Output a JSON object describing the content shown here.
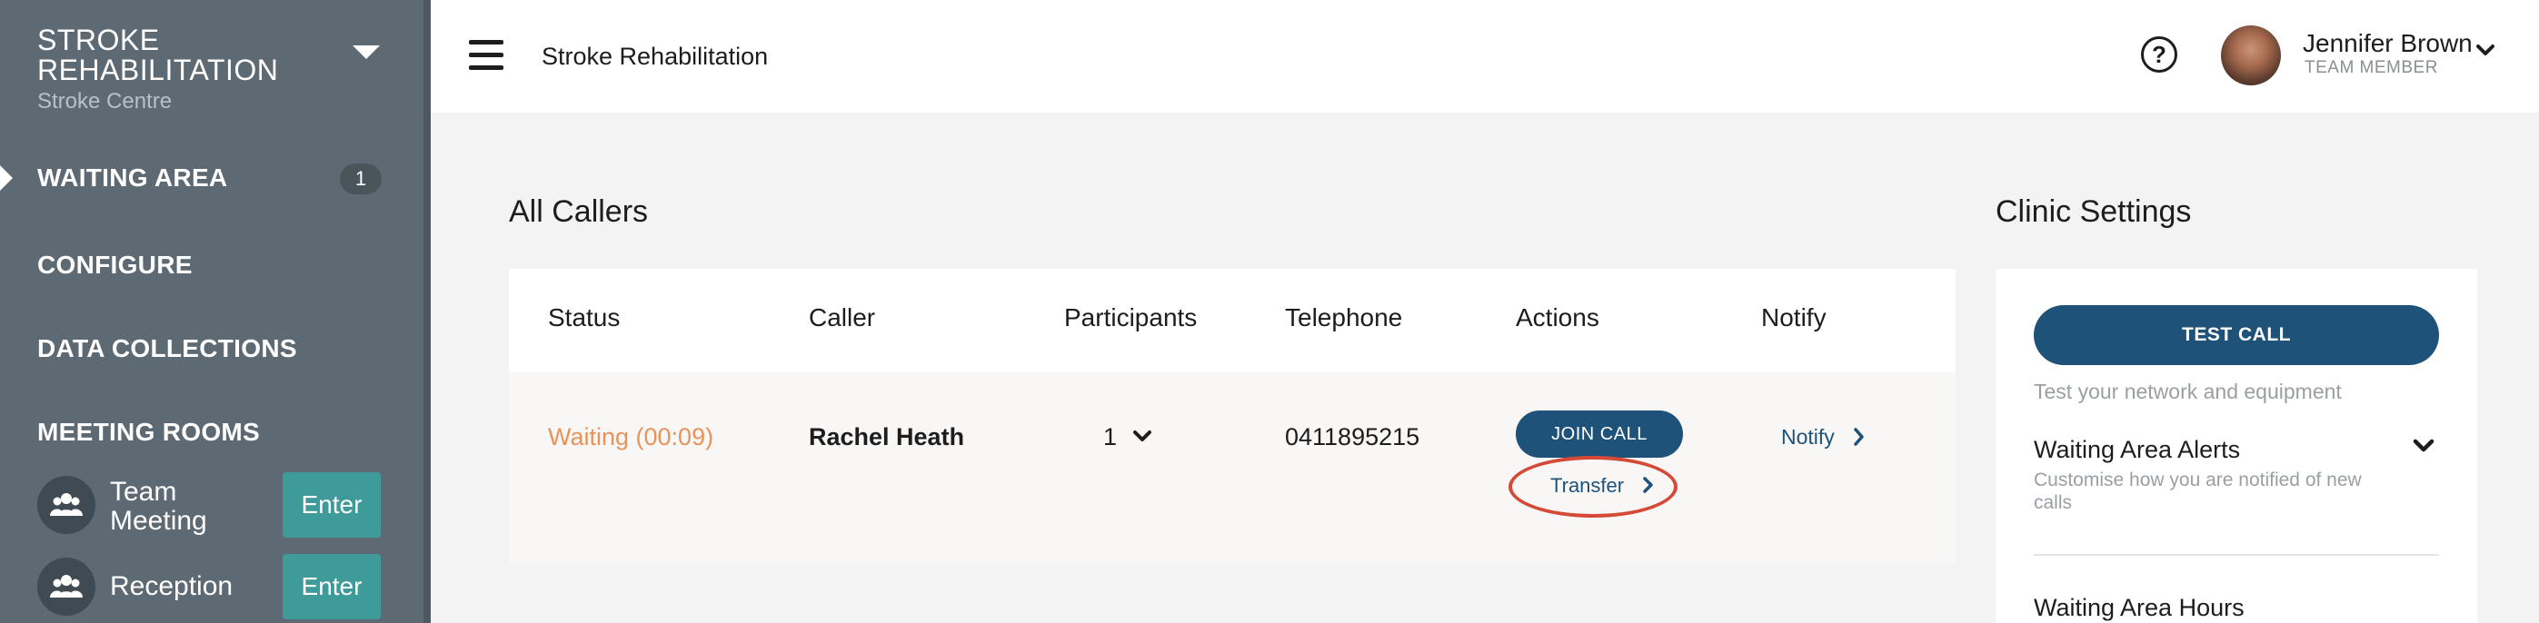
{
  "sidebar": {
    "clinic_name": "STROKE REHABILITATION",
    "clinic_subtitle": "Stroke Centre",
    "nav": {
      "waiting_area": "WAITING AREA",
      "waiting_area_count": "1",
      "configure": "CONFIGURE",
      "data_collections": "DATA COLLECTIONS",
      "meeting_rooms": "MEETING ROOMS"
    },
    "rooms": [
      {
        "label": "Team Meeting",
        "enter_label": "Enter"
      },
      {
        "label": "Reception",
        "enter_label": "Enter"
      }
    ]
  },
  "header": {
    "title": "Stroke Rehabilitation",
    "help_icon": "?",
    "user": {
      "name": "Jennifer Brown",
      "role": "TEAM MEMBER"
    }
  },
  "callers": {
    "title": "All Callers",
    "columns": {
      "status": "Status",
      "caller": "Caller",
      "participants": "Participants",
      "telephone": "Telephone",
      "actions": "Actions",
      "notify": "Notify"
    },
    "rows": [
      {
        "status": "Waiting (00:09)",
        "caller": "Rachel Heath",
        "participants": "1",
        "telephone": "0411895215",
        "join_label": "JOIN CALL",
        "transfer_label": "Transfer",
        "notify_label": "Notify"
      }
    ]
  },
  "settings": {
    "title": "Clinic Settings",
    "test_call_label": "TEST CALL",
    "test_call_hint": "Test your network and equipment",
    "alerts_title": "Waiting Area Alerts",
    "alerts_desc": "Customise how you are notified of new calls",
    "hours_title": "Waiting Area Hours"
  },
  "colors": {
    "sidebar_bg": "#5e6a73",
    "primary": "#1f5278",
    "enter_button": "#3e9b9a",
    "status_waiting": "#e8935a",
    "highlight_ring": "#d54a36"
  }
}
